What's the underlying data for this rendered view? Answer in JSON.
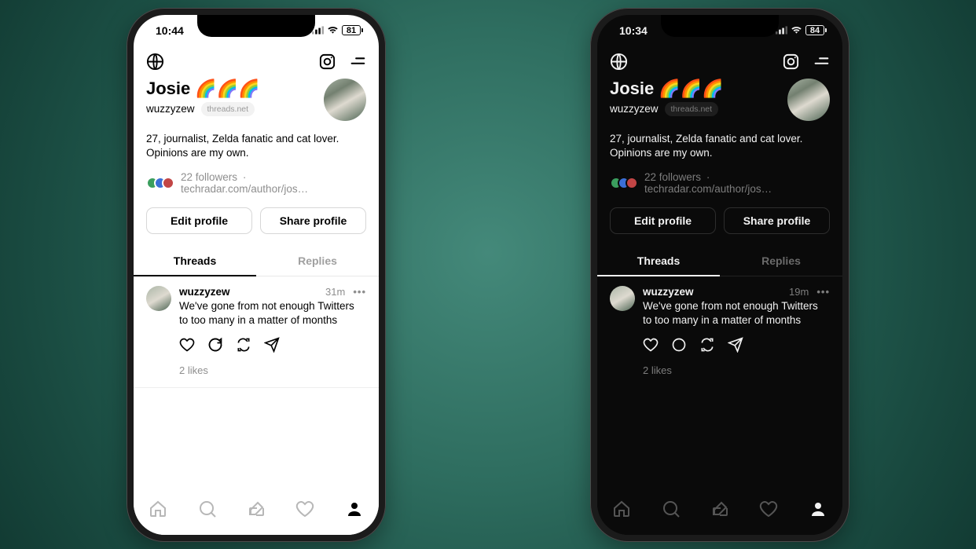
{
  "phones": [
    {
      "theme": "light",
      "status": {
        "time": "10:44",
        "battery": "81"
      },
      "post_time": "31m"
    },
    {
      "theme": "dark",
      "status": {
        "time": "10:34",
        "battery": "84"
      },
      "post_time": "19m"
    }
  ],
  "profile": {
    "display_name": "Josie 🌈🌈🌈",
    "handle": "wuzzyzew",
    "domain_chip": "threads.net",
    "bio": "27, journalist, Zelda fanatic and cat lover. Opinions are my own.",
    "followers_text": "22 followers",
    "separator": "·",
    "link_text": "techradar.com/author/jos…",
    "edit_btn": "Edit profile",
    "share_btn": "Share profile"
  },
  "tabs": {
    "threads": "Threads",
    "replies": "Replies"
  },
  "post": {
    "user": "wuzzyzew",
    "text": "We've gone from not enough Twitters to too many in a matter of months",
    "likes": "2 likes"
  }
}
